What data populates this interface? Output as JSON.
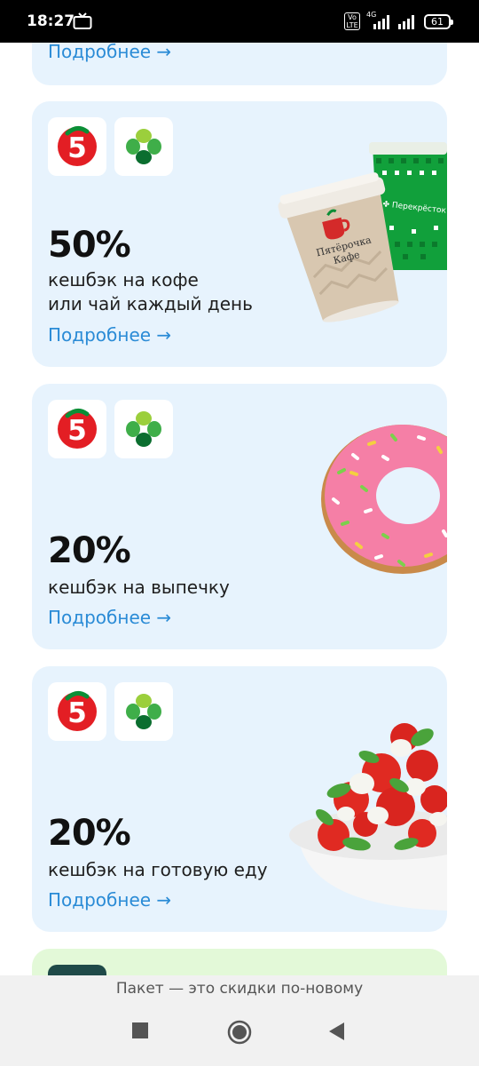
{
  "status_bar": {
    "time": "18:27",
    "volte": "Vo LTE",
    "network": "4G",
    "battery": "61"
  },
  "cards": [
    {
      "more_label": "Подробнее →"
    },
    {
      "percent": "50%",
      "description_line1": "кешбэк на кофе",
      "description_line2": "или чай каждый день",
      "more_label": "Подробнее →",
      "cup_brand_left_line1": "Пятёрочка",
      "cup_brand_left_line2": "Кафе",
      "cup_brand_right": "✤ Перекрёсток"
    },
    {
      "percent": "20%",
      "description": "кешбэк на выпечку",
      "more_label": "Подробнее →"
    },
    {
      "percent": "20%",
      "description": "кешбэк на готовую еду",
      "more_label": "Подробнее →"
    }
  ],
  "bottom_note": "Пакет — это скидки по-новому",
  "colors": {
    "card_bg": "#e7f3fd",
    "link": "#2a8bd6",
    "pyaterochka_red": "#e31e24",
    "perekrestok_green": "#0b8e36"
  },
  "icons": [
    "pyaterochka-logo",
    "perekrestok-logo",
    "stop-icon",
    "home-icon",
    "back-icon"
  ]
}
